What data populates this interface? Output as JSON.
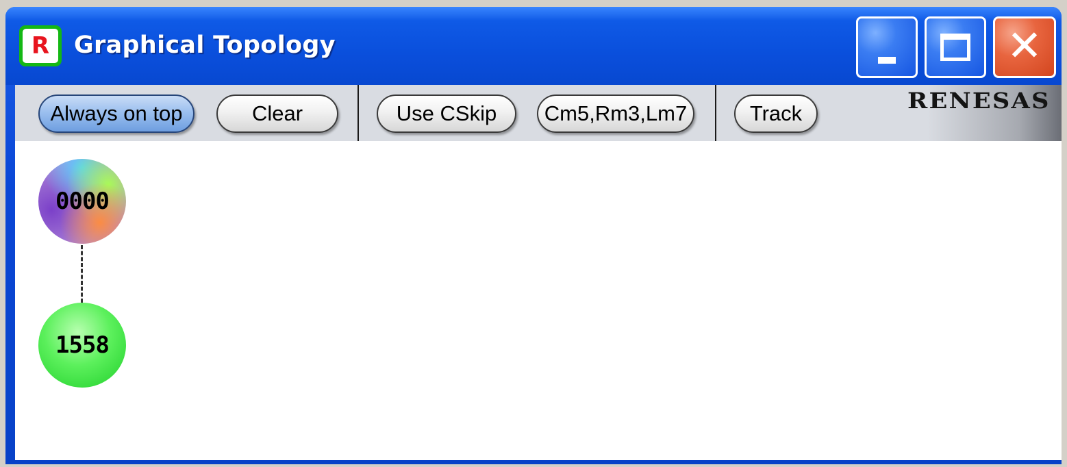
{
  "window": {
    "title": "Graphical Topology",
    "app_icon_glyph": "R",
    "controls": {
      "minimize": "minimize-icon",
      "maximize": "maximize-icon",
      "close": "close-icon"
    }
  },
  "toolbar": {
    "always_on_top_label": "Always on top",
    "clear_label": "Clear",
    "use_cskip_label": "Use CSkip",
    "cm_rm_lm_label": "Cm5,Rm3,Lm7",
    "track_label": "Track",
    "brand_logo": "RENESAS"
  },
  "topology": {
    "nodes": [
      {
        "id": "0000"
      },
      {
        "id": "1558"
      }
    ],
    "links": [
      {
        "from": "0000",
        "to": "1558",
        "style": "dashed"
      }
    ]
  },
  "colors": {
    "title_bar": "#0a4fdc",
    "close_button": "#d2451e",
    "toolbar_bg": "#d9dce2",
    "active_button": "#9cc0ef",
    "node_1558": "#1fcf2a"
  }
}
